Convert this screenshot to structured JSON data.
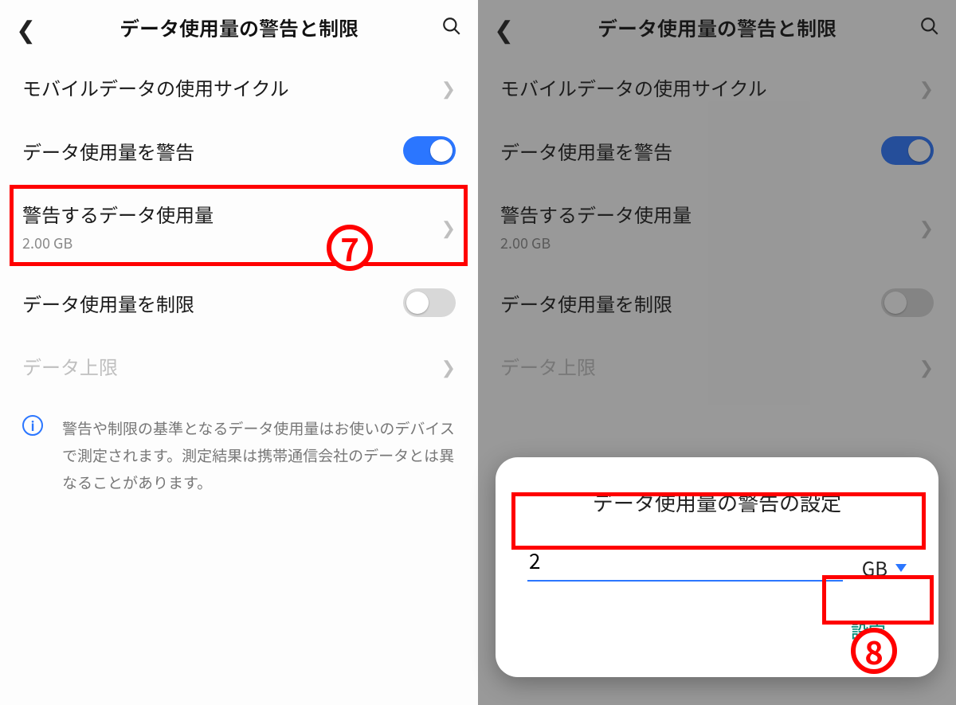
{
  "header": {
    "title": "データ使用量の警告と制限"
  },
  "items": {
    "cycle": {
      "label": "モバイルデータの使用サイクル"
    },
    "warn_toggle": {
      "label": "データ使用量を警告"
    },
    "warn_amount": {
      "label": "警告するデータ使用量",
      "value": "2.00 GB"
    },
    "limit_toggle": {
      "label": "データ使用量を制限"
    },
    "limit_amount": {
      "label": "データ上限"
    }
  },
  "info_text": "警告や制限の基準となるデータ使用量はお使いのデバイスで測定されます。測定結果は携帯通信会社のデータとは異なることがあります。",
  "dialog": {
    "title": "データ使用量の警告の設定",
    "value": "2",
    "unit": "GB",
    "confirm": "設定"
  },
  "annotations": {
    "step7": "7",
    "step8": "8"
  }
}
